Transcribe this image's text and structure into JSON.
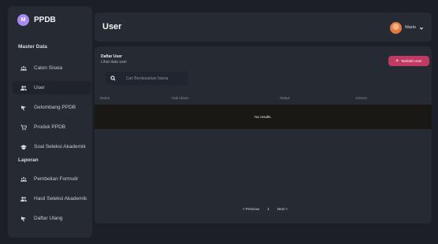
{
  "sidebar": {
    "brand_initial": "M",
    "brand_name": "PPDB",
    "sections": [
      {
        "title": "Master Data",
        "items": [
          {
            "label": "Calon Siswa",
            "icon": "users-icon"
          },
          {
            "label": "User",
            "icon": "user-group-icon",
            "active": true
          },
          {
            "label": "Gelombang PPDB",
            "icon": "flag-icon"
          },
          {
            "label": "Produk PPDB",
            "icon": "cart-icon"
          },
          {
            "label": "Soal Seleksi Akademik",
            "icon": "graduation-cap-icon"
          }
        ]
      },
      {
        "title": "Laporan",
        "items": [
          {
            "label": "Pembelian Formulir",
            "icon": "users-icon"
          },
          {
            "label": "Hasil Seleksi Akademik",
            "icon": "user-group-icon"
          },
          {
            "label": "Daftar Ulang",
            "icon": "flag-icon"
          }
        ]
      }
    ]
  },
  "header": {
    "title": "User",
    "user_name": "Mario"
  },
  "main": {
    "list_title": "Daftar User",
    "list_subtitle": "Lihat data user",
    "add_button": "Tambah User",
    "search_placeholder": "Cari Berdasarkan Nama",
    "columns": [
      "Nama",
      "Hak Akses",
      "Status",
      "Actions"
    ],
    "empty_message": "No results.",
    "pagination": {
      "prev": "< Previous",
      "page": "1",
      "next": "Next >"
    }
  },
  "colors": {
    "background": "#1c1f26",
    "panel": "#262a33",
    "accent": "#c23a62",
    "brand": "#a889f0"
  }
}
